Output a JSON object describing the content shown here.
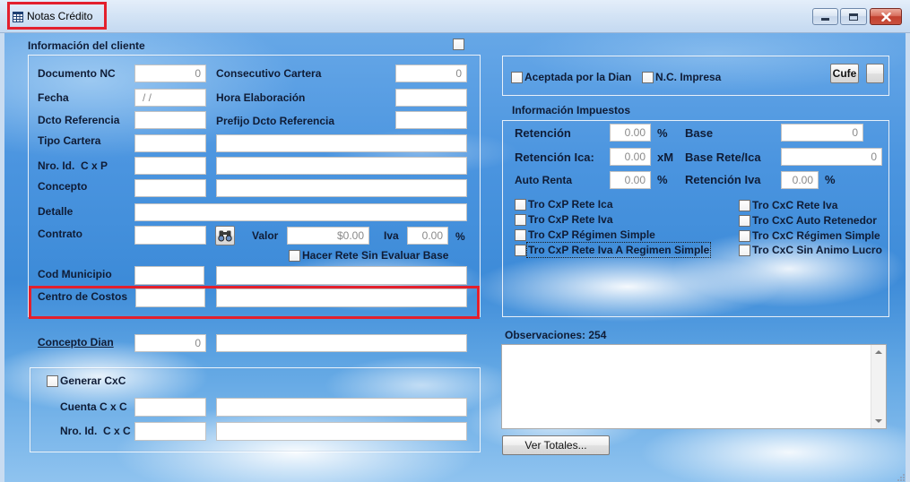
{
  "window": {
    "title": "Notas Crédito",
    "icon": "table-icon",
    "controls": {
      "minimize": "minimize-icon",
      "maximize": "maximize-icon",
      "close": "close-icon"
    }
  },
  "colors": {
    "highlight": "#e3202d",
    "close_button": "#c2402f",
    "sky": "#3d8bd8"
  },
  "cliente": {
    "section_title": "Información del cliente",
    "section_checked": false,
    "documento_nc": {
      "label": "Documento NC",
      "value": "0"
    },
    "consecutivo_cartera": {
      "label": "Consecutivo Cartera",
      "value": "0"
    },
    "fecha": {
      "label": "Fecha",
      "value": "/ /"
    },
    "hora_elaboracion": {
      "label": "Hora Elaboración",
      "value": ""
    },
    "dcto_referencia": {
      "label": "Dcto Referencia",
      "value": ""
    },
    "prefijo_dcto_referencia": {
      "label": "Prefijo Dcto Referencia",
      "value": ""
    },
    "tipo_cartera": {
      "label": "Tipo Cartera",
      "code": "",
      "description": ""
    },
    "nro_id_cxp": {
      "label": "Nro. Id.  C x P",
      "code": "",
      "description": ""
    },
    "concepto": {
      "label": "Concepto",
      "code": "",
      "description": ""
    },
    "detalle": {
      "label": "Detalle",
      "value": ""
    },
    "contrato": {
      "label": "Contrato",
      "value": "",
      "search_icon": "binoculars-icon"
    },
    "valor": {
      "label": "Valor",
      "value": "$0.00"
    },
    "iva": {
      "label": "Iva",
      "value": "0.00",
      "unit": "%"
    },
    "hacer_rete_sin_evaluar_base": {
      "label": "Hacer Rete Sin Evaluar Base",
      "checked": false
    },
    "cod_municipio": {
      "label": "Cod Municipio",
      "code": "",
      "description": ""
    },
    "centro_de_costos": {
      "label": "Centro de Costos",
      "code": "",
      "description": ""
    }
  },
  "concepto_dian": {
    "label": "Concepto Dian",
    "code": "0",
    "description": ""
  },
  "cxc": {
    "generar": {
      "label": "Generar CxC",
      "checked": false
    },
    "cuenta": {
      "label": "Cuenta C x C",
      "code": "",
      "description": ""
    },
    "nro_id": {
      "label": "Nro. Id.  C x C",
      "code": "",
      "description": ""
    }
  },
  "estado": {
    "aceptada_dian": {
      "label": "Aceptada por la Dian",
      "checked": false
    },
    "nc_impresa": {
      "label": "N.C. Impresa",
      "checked": false
    },
    "cufe_button": "Cufe"
  },
  "impuestos": {
    "section_title": "Información Impuestos",
    "retencion": {
      "label": "Retención",
      "value": "0.00",
      "unit": "%"
    },
    "base": {
      "label": "Base",
      "value": "0"
    },
    "retencion_ica": {
      "label": "Retención Ica:",
      "value": "0.00",
      "unit": "xM"
    },
    "base_rete_ica": {
      "label": "Base Rete/Ica",
      "value": "0"
    },
    "auto_renta": {
      "label": "Auto Renta",
      "value": "0.00",
      "unit": "%"
    },
    "retencion_iva": {
      "label": "Retención Iva",
      "value": "0.00",
      "unit": "%"
    },
    "checks_cxp": [
      {
        "label": "Tro CxP Rete Ica",
        "checked": false
      },
      {
        "label": "Tro CxP Rete Iva",
        "checked": false
      },
      {
        "label": "Tro CxP Régimen Simple",
        "checked": false
      },
      {
        "label": "Tro CxP Rete Iva A Regimen Simple",
        "checked": false
      }
    ],
    "checks_cxc": [
      {
        "label": "Tro CxC Rete Iva",
        "checked": false
      },
      {
        "label": "Tro CxC Auto Retenedor",
        "checked": false
      },
      {
        "label": "Tro CxC Régimen Simple",
        "checked": false
      },
      {
        "label": "Tro CxC Sin Animo Lucro",
        "checked": false
      }
    ]
  },
  "observaciones": {
    "label": "Observaciones: 254",
    "value": ""
  },
  "ver_totales_button": "Ver Totales..."
}
